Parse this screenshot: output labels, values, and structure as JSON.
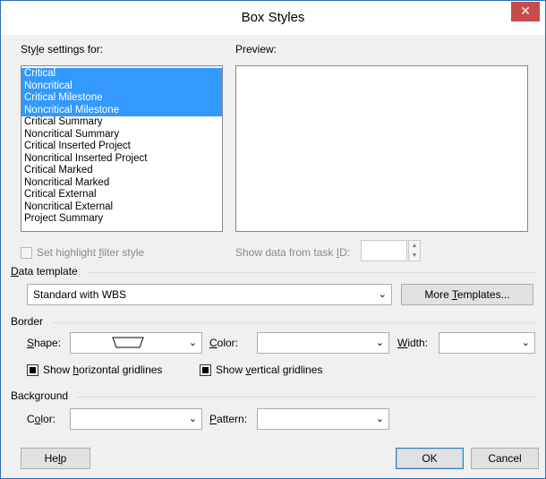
{
  "window": {
    "title": "Box Styles",
    "close_glyph": "✕"
  },
  "style_settings": {
    "label_pre": "Sty",
    "label_u": "l",
    "label_post": "e settings for:",
    "items": [
      {
        "label": "Critical",
        "selected": true
      },
      {
        "label": "Noncritical",
        "selected": true
      },
      {
        "label": "Critical Milestone",
        "selected": true
      },
      {
        "label": "Noncritical Milestone",
        "selected": true
      },
      {
        "label": "Critical Summary",
        "selected": false
      },
      {
        "label": "Noncritical Summary",
        "selected": false
      },
      {
        "label": "Critical Inserted Project",
        "selected": false
      },
      {
        "label": "Noncritical Inserted Project",
        "selected": false
      },
      {
        "label": "Critical Marked",
        "selected": false
      },
      {
        "label": "Noncritical Marked",
        "selected": false
      },
      {
        "label": "Critical External",
        "selected": false
      },
      {
        "label": "Noncritical External",
        "selected": false
      },
      {
        "label": "Project Summary",
        "selected": false
      }
    ]
  },
  "preview": {
    "label": "Preview:"
  },
  "highlight": {
    "label_pre": "Set highlight ",
    "label_u": "f",
    "label_post": "ilter style",
    "checked": false,
    "enabled": false
  },
  "task_id": {
    "label_pre": "Show data from task ",
    "label_u": "I",
    "label_post": "D:",
    "value": ""
  },
  "data_template": {
    "section_pre": "",
    "section_u": "D",
    "section_post": "ata template",
    "selected": "Standard with WBS",
    "more_button_pre": "More ",
    "more_button_u": "T",
    "more_button_post": "emplates..."
  },
  "border": {
    "section": "Border",
    "shape_label_u": "S",
    "shape_label_post": "hape:",
    "color_label_u": "C",
    "color_label_post": "olor:",
    "color_value": "",
    "width_label_u": "W",
    "width_label_post": "idth:",
    "width_value": "",
    "horizontal_gridlines": {
      "label_pre": "Show ",
      "label_u": "h",
      "label_post": "orizontal gridlines",
      "checked": true
    },
    "vertical_gridlines": {
      "label_pre": "Show ",
      "label_u": "v",
      "label_post": "ertical gridlines",
      "checked": true
    }
  },
  "background": {
    "section": "Background",
    "color_label_pre": "C",
    "color_label_u": "o",
    "color_label_post": "lor:",
    "color_value": "",
    "pattern_label_u": "P",
    "pattern_label_post": "attern:",
    "pattern_value": ""
  },
  "buttons": {
    "help_pre": "He",
    "help_u": "l",
    "help_post": "p",
    "ok": "OK",
    "cancel": "Cancel"
  },
  "icons": {
    "dropdown": "chevron-down-icon",
    "spin_up": "▲",
    "spin_down": "▼",
    "arrow_glyph": "⌄"
  },
  "colors": {
    "selection": "#3399ff",
    "close_button": "#c74b4b",
    "window_border": "#2b6fb3"
  }
}
